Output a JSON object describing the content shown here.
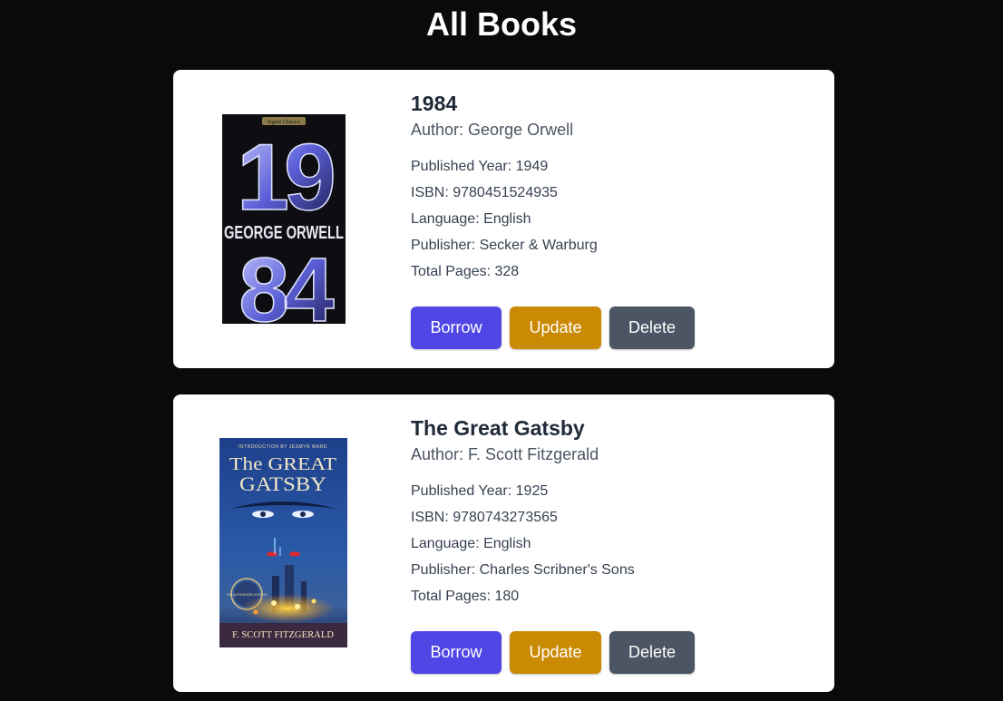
{
  "page": {
    "title": "All Books"
  },
  "labels": {
    "author": "Author: ",
    "published_year": "Published Year: ",
    "isbn": "ISBN: ",
    "language": "Language: ",
    "publisher": "Publisher: ",
    "total_pages": "Total Pages: "
  },
  "buttons": {
    "borrow": "Borrow",
    "update": "Update",
    "delete": "Delete"
  },
  "colors": {
    "borrow": "#4f46e5",
    "update": "#ca8a04",
    "delete": "#4b5563",
    "background": "#0a0a0a"
  },
  "books": [
    {
      "title": "1984",
      "author": "George Orwell",
      "published_year": "1949",
      "isbn": "9780451524935",
      "language": "English",
      "publisher": "Secker & Warburg",
      "total_pages": "328",
      "cover": {
        "top_text": "19",
        "name_text": "GEORGE ORWELL",
        "bottom_text": "84",
        "imprint": "Signet Classics"
      }
    },
    {
      "title": "The Great Gatsby",
      "author": "F. Scott Fitzgerald",
      "published_year": "1925",
      "isbn": "9780743273565",
      "language": "English",
      "publisher": "Charles Scribner's Sons",
      "total_pages": "180",
      "cover": {
        "intro": "INTRODUCTION BY JESMYN WARD",
        "title_1": "The GREAT",
        "title_2": "GATSBY",
        "author": "F. SCOTT FITZGERALD",
        "seal": "THE AUTHORIZED EDITION"
      }
    }
  ]
}
